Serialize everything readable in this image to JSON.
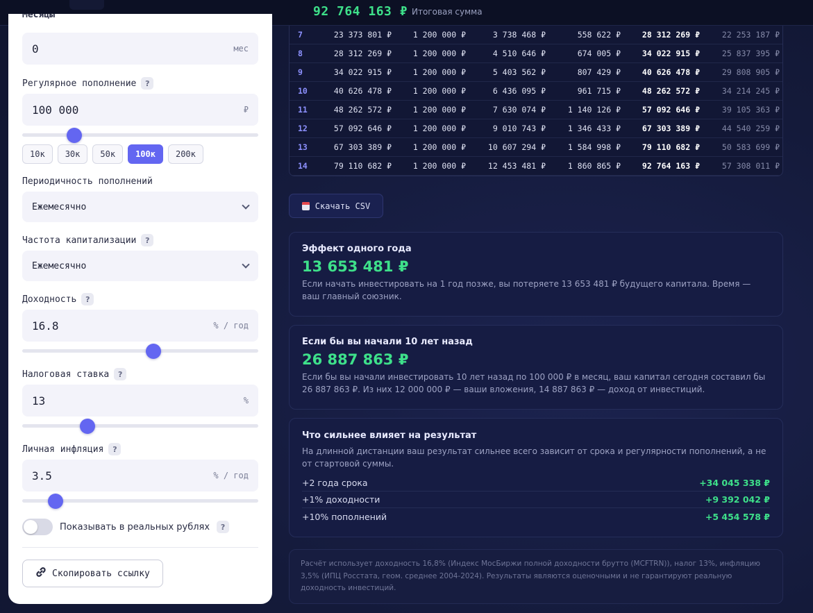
{
  "topbar": {
    "total_value": "92 764 163 ₽",
    "total_label": "Итоговая сумма"
  },
  "form": {
    "cut_label": "Месяцы",
    "months": {
      "value": "0",
      "unit": "мес"
    },
    "regular_deposit": {
      "label": "Регулярное пополнение",
      "help": "?",
      "value": "100 000",
      "unit": "₽",
      "slider_level": 0.22,
      "presets": [
        "10к",
        "30к",
        "50к",
        "100к",
        "200к"
      ],
      "active_preset": "100к"
    },
    "deposit_frequency": {
      "label": "Периодичность пополнений",
      "value": "Ежемесячно"
    },
    "capitalization": {
      "label": "Частота капитализации",
      "help": "?",
      "value": "Ежемесячно"
    },
    "yield": {
      "label": "Доходность",
      "help": "?",
      "value": "16.8",
      "unit": "% / год",
      "slider_level": 0.557
    },
    "tax": {
      "label": "Налоговая ставка",
      "help": "?",
      "value": "13",
      "unit": "%",
      "slider_level": 0.276
    },
    "inflation": {
      "label": "Личная инфляция",
      "help": "?",
      "value": "3.5",
      "unit": "% / год",
      "slider_level": 0.141
    },
    "real_rubles": {
      "label": "Показывать в реальных рублях",
      "help": "?",
      "enabled": false
    },
    "copy_link_label": "Скопировать ссылку"
  },
  "table": {
    "rows": [
      [
        "7",
        "23 373 801 ₽",
        "1 200 000 ₽",
        "3 738 468 ₽",
        "558 622 ₽",
        "28 312 269 ₽",
        "22 253 187 ₽"
      ],
      [
        "8",
        "28 312 269 ₽",
        "1 200 000 ₽",
        "4 510 646 ₽",
        "674 005 ₽",
        "34 022 915 ₽",
        "25 837 395 ₽"
      ],
      [
        "9",
        "34 022 915 ₽",
        "1 200 000 ₽",
        "5 403 562 ₽",
        "807 429 ₽",
        "40 626 478 ₽",
        "29 808 905 ₽"
      ],
      [
        "10",
        "40 626 478 ₽",
        "1 200 000 ₽",
        "6 436 095 ₽",
        "961 715 ₽",
        "48 262 572 ₽",
        "34 214 245 ₽"
      ],
      [
        "11",
        "48 262 572 ₽",
        "1 200 000 ₽",
        "7 630 074 ₽",
        "1 140 126 ₽",
        "57 092 646 ₽",
        "39 105 363 ₽"
      ],
      [
        "12",
        "57 092 646 ₽",
        "1 200 000 ₽",
        "9 010 743 ₽",
        "1 346 433 ₽",
        "67 303 389 ₽",
        "44 540 259 ₽"
      ],
      [
        "13",
        "67 303 389 ₽",
        "1 200 000 ₽",
        "10 607 294 ₽",
        "1 584 998 ₽",
        "79 110 682 ₽",
        "50 583 699 ₽"
      ],
      [
        "14",
        "79 110 682 ₽",
        "1 200 000 ₽",
        "12 453 481 ₽",
        "1 860 865 ₽",
        "92 764 163 ₽",
        "57 308 011 ₽"
      ]
    ]
  },
  "csv_label": "Скачать CSV",
  "cards": {
    "one_year": {
      "title": "Эффект одного года",
      "value": "13 653 481 ₽",
      "text": "Если начать инвестировать на 1 год позже, вы потеряете 13 653 481 ₽ будущего капитала. Время — ваш главный союзник."
    },
    "ten_years": {
      "title": "Если бы вы начали 10 лет назад",
      "value": "26 887 863 ₽",
      "text": "Если бы вы начали инвестировать 10 лет назад по 100 000 ₽ в месяц, ваш капитал сегодня составил бы 26 887 863 ₽. Из них 12 000 000 ₽ — ваши вложения, 14 887 863 ₽ — доход от инвестиций."
    },
    "impact": {
      "title": "Что сильнее влияет на результат",
      "text": "На длинной дистанции ваш результат сильнее всего зависит от срока и регулярности пополнений, а не от стартовой суммы.",
      "rows": [
        {
          "label": "+2 года срока",
          "value": "+34 045 338 ₽"
        },
        {
          "label": "+1% доходности",
          "value": "+9 392 042 ₽"
        },
        {
          "label": "+10% пополнений",
          "value": "+5 454 578 ₽"
        }
      ]
    }
  },
  "disclaimer": "Расчёт использует доходность 16,8% (Индекс МосБиржи полной доходности брутто (MCFTRN)), налог 13%, инфляцию 3,5% (ИПЦ Росстата, геом. среднее 2004-2024). Результаты являются оценочными и не гарантируют реальную доходность инвестиций.",
  "colors": {
    "accent": "#6366f1",
    "positive": "#3ee08a",
    "background": "#141a3a"
  }
}
